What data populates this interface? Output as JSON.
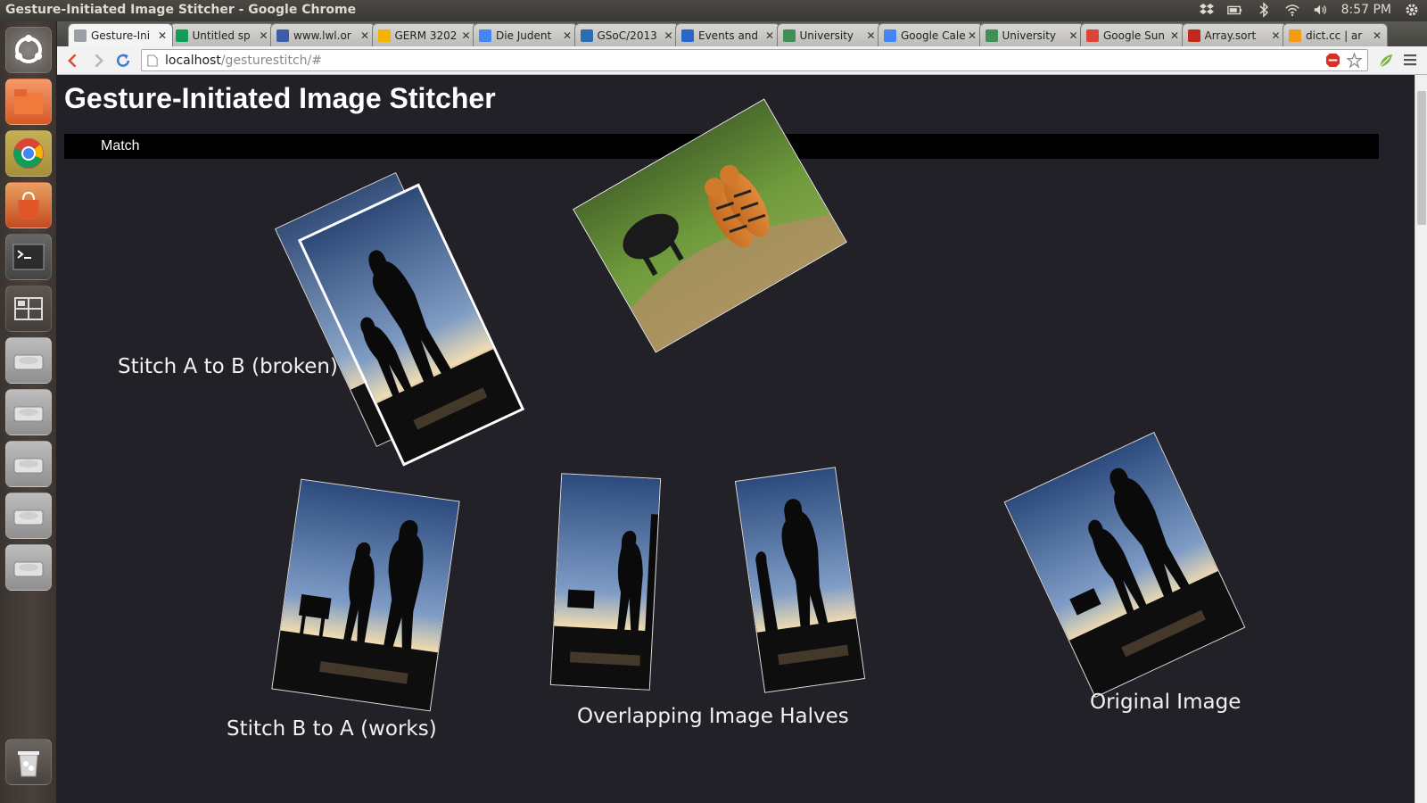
{
  "window": {
    "title": "Gesture-Initiated Image Stitcher - Google Chrome"
  },
  "panel": {
    "clock": "8:57 PM"
  },
  "tabs": [
    {
      "label": "Gesture-Ini",
      "favicon": "page-icon",
      "color": "#9aa0a6"
    },
    {
      "label": "Untitled sp",
      "favicon": "sheets-icon",
      "color": "#0f9d58"
    },
    {
      "label": "www.lwl.or",
      "favicon": "lwl-icon",
      "color": "#3b5ea6"
    },
    {
      "label": "GERM 3202",
      "favicon": "drive-icon",
      "color": "#f4b400"
    },
    {
      "label": "Die Judent",
      "favicon": "docs-icon",
      "color": "#4285f4"
    },
    {
      "label": "GSoC/2013",
      "favicon": "kde-icon",
      "color": "#2a6db5"
    },
    {
      "label": "Events and",
      "favicon": "meetup-icon",
      "color": "#2966c8"
    },
    {
      "label": "University",
      "favicon": "university-icon",
      "color": "#3f8f56"
    },
    {
      "label": "Google Cale",
      "favicon": "calendar-icon",
      "color": "#4285f4"
    },
    {
      "label": "University",
      "favicon": "university-icon",
      "color": "#3f8f56"
    },
    {
      "label": "Google Sun",
      "favicon": "google-icon",
      "color": "#db4437"
    },
    {
      "label": "Array.sort",
      "favicon": "mdn-icon",
      "color": "#c0281c"
    },
    {
      "label": "dict.cc | ar",
      "favicon": "dictcc-icon",
      "color": "#f39c12"
    }
  ],
  "omnibox": {
    "host": "localhost",
    "path": "/gesturestitch/#"
  },
  "page": {
    "heading": "Gesture-Initiated Image Stitcher",
    "match_label": "Match",
    "captions": {
      "broken": "Stitch A to B (broken)",
      "works": "Stitch B to A (works)",
      "halves": "Overlapping Image Halves",
      "original": "Original Image"
    }
  }
}
